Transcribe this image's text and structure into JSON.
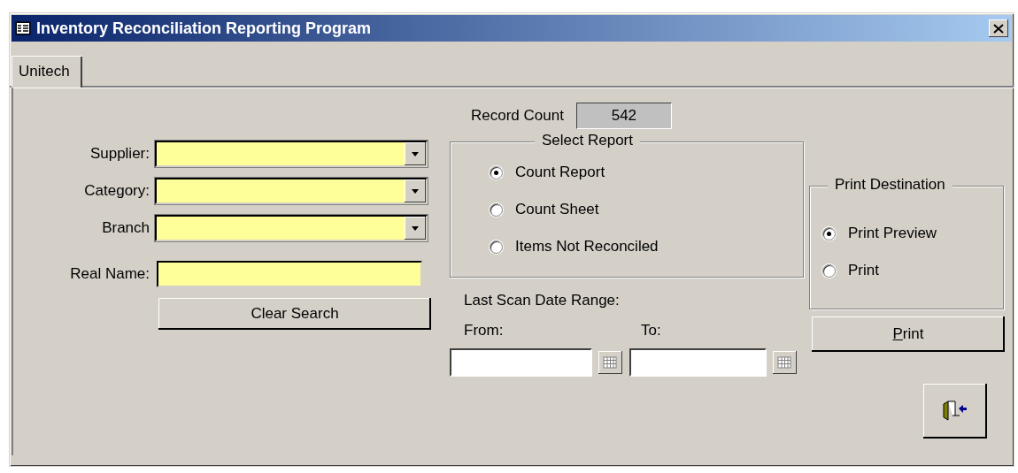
{
  "window": {
    "title": "Inventory Reconciliation Reporting Program"
  },
  "tabs": [
    {
      "label": "Unitech",
      "selected": true
    }
  ],
  "filters": [
    {
      "label": "Supplier:",
      "kind": "combo"
    },
    {
      "label": "Category:",
      "kind": "combo"
    },
    {
      "label": "Branch",
      "kind": "combo"
    },
    {
      "label": "Real Name:",
      "kind": "text"
    }
  ],
  "clear_button": {
    "label": "Clear Search"
  },
  "record_count": {
    "label": "Record Count",
    "value": "542"
  },
  "select_report": {
    "title": "Select Report",
    "options": [
      {
        "label": "Count Report",
        "selected": true
      },
      {
        "label": "Count Sheet",
        "selected": false
      },
      {
        "label": "Items Not Reconciled",
        "selected": false
      }
    ]
  },
  "date_range": {
    "label": "Last Scan Date Range:",
    "from_label": "From:",
    "to_label": "To:"
  },
  "print_destination": {
    "title": "Print Destination",
    "options": [
      {
        "label": "Print Preview",
        "selected": true
      },
      {
        "label": "Print",
        "selected": false
      }
    ]
  },
  "print_button": {
    "label": "Print"
  }
}
